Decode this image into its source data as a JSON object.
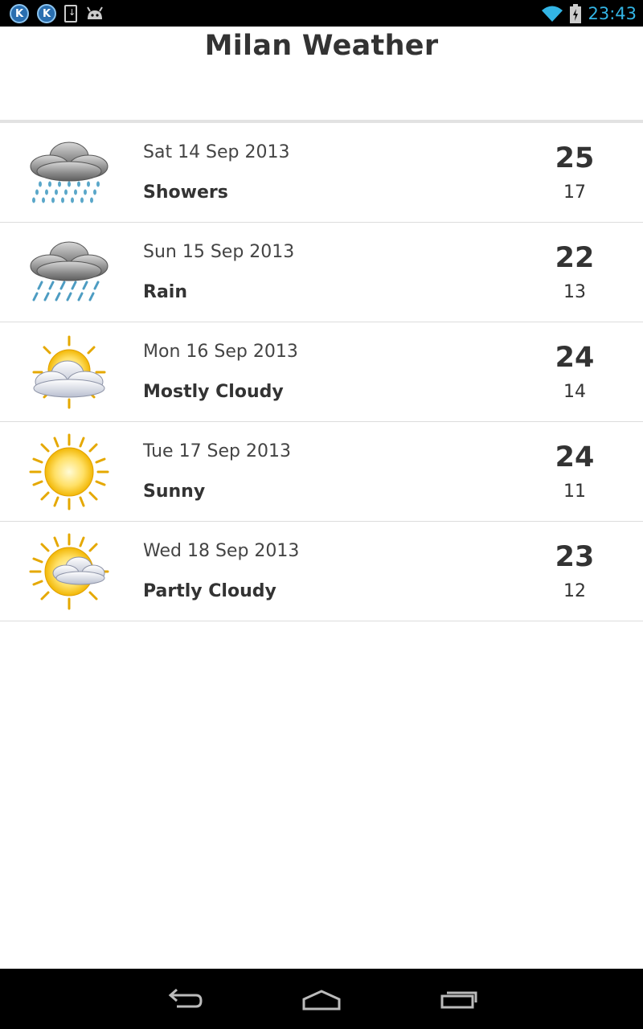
{
  "status_bar": {
    "time": "23:43",
    "clock_color": "#33b5e5",
    "left_icons": [
      "k-app-icon",
      "k-app-icon",
      "download-icon",
      "android-debug-icon"
    ],
    "right_icons": [
      "wifi-icon",
      "battery-charging-icon"
    ]
  },
  "header": {
    "title": "Milan Weather"
  },
  "forecast": [
    {
      "date": "Sat 14 Sep 2013",
      "condition": "Showers",
      "high": "25",
      "low": "17",
      "icon": "showers-icon"
    },
    {
      "date": "Sun 15 Sep 2013",
      "condition": "Rain",
      "high": "22",
      "low": "13",
      "icon": "rain-icon"
    },
    {
      "date": "Mon 16 Sep 2013",
      "condition": "Mostly Cloudy",
      "high": "24",
      "low": "14",
      "icon": "mostly-cloudy-icon"
    },
    {
      "date": "Tue 17 Sep 2013",
      "condition": "Sunny",
      "high": "24",
      "low": "11",
      "icon": "sunny-icon"
    },
    {
      "date": "Wed 18 Sep 2013",
      "condition": "Partly Cloudy",
      "high": "23",
      "low": "12",
      "icon": "partly-cloudy-icon"
    }
  ],
  "nav_bar": {
    "buttons": [
      "back-button",
      "home-button",
      "recent-apps-button"
    ]
  }
}
